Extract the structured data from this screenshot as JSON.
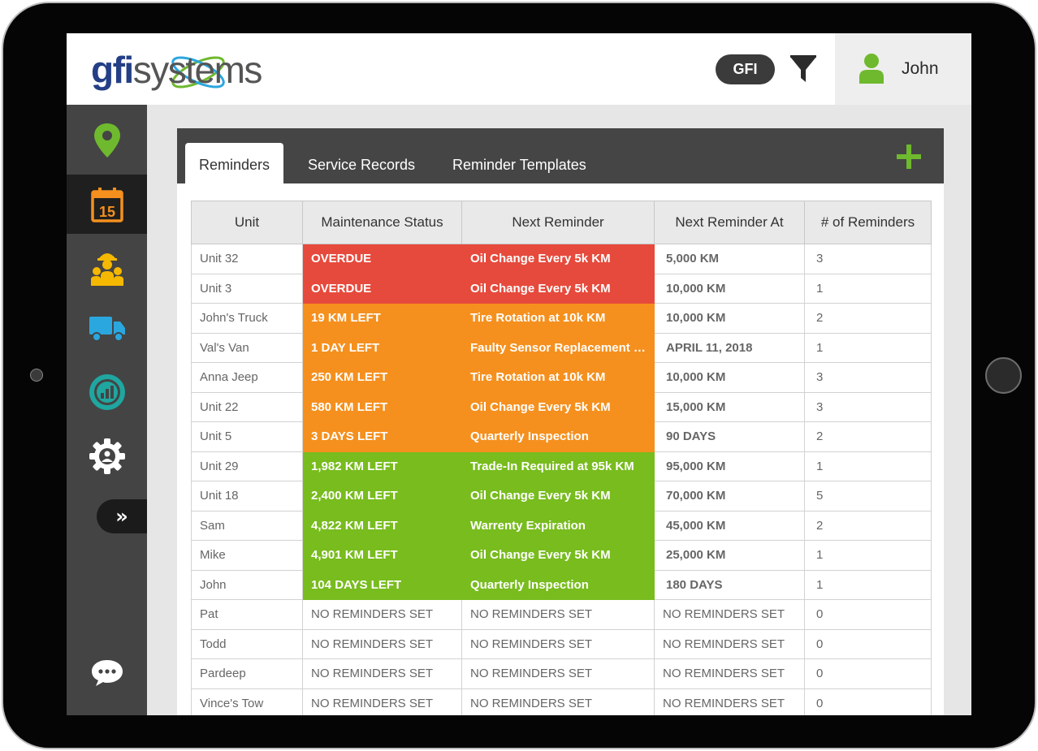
{
  "header": {
    "logo": {
      "part1": "gfi",
      "part2": "systems"
    },
    "org_badge": "GFI",
    "user_name": "John"
  },
  "colors": {
    "overdue": "#e64a3c",
    "warning": "#f5901e",
    "ok": "#78bc1e",
    "brand_green": "#6fb92e",
    "brand_blue": "#243f86"
  },
  "sidebar": {
    "items": [
      {
        "icon": "map-pin-icon",
        "active": false
      },
      {
        "icon": "calendar-icon",
        "active": true,
        "day": "15"
      },
      {
        "icon": "workers-icon",
        "active": false
      },
      {
        "icon": "truck-icon",
        "active": false
      },
      {
        "icon": "analytics-icon",
        "active": false
      },
      {
        "icon": "settings-icon",
        "active": false
      }
    ],
    "expand": "»",
    "chat_icon": "chat-icon"
  },
  "tabs": [
    {
      "label": "Reminders",
      "active": true
    },
    {
      "label": "Service Records",
      "active": false
    },
    {
      "label": "Reminder Templates",
      "active": false
    }
  ],
  "table": {
    "columns": [
      "Unit",
      "Maintenance Status",
      "Next Reminder",
      "Next Reminder At",
      "# of Reminders"
    ],
    "rows": [
      {
        "unit": "Unit 32",
        "status": "OVERDUE",
        "level": "overdue",
        "reminder": "Oil Change Every 5k KM",
        "at": "5,000 KM",
        "count": "3"
      },
      {
        "unit": "Unit 3",
        "status": "OVERDUE",
        "level": "overdue",
        "reminder": "Oil Change Every 5k KM",
        "at": "10,000 KM",
        "count": "1"
      },
      {
        "unit": "John's Truck",
        "status": "19 KM LEFT",
        "level": "warning",
        "reminder": "Tire Rotation at 10k KM",
        "at": "10,000 KM",
        "count": "2"
      },
      {
        "unit": "Val's Van",
        "status": "1 DAY LEFT",
        "level": "warning",
        "reminder": "Faulty Sensor Replacement Required",
        "at": "APRIL 11, 2018",
        "count": "1"
      },
      {
        "unit": "Anna Jeep",
        "status": "250 KM LEFT",
        "level": "warning",
        "reminder": "Tire Rotation at 10k KM",
        "at": "10,000 KM",
        "count": "3"
      },
      {
        "unit": "Unit 22",
        "status": "580 KM LEFT",
        "level": "warning",
        "reminder": "Oil Change Every 5k KM",
        "at": "15,000 KM",
        "count": "3"
      },
      {
        "unit": "Unit 5",
        "status": "3 DAYS LEFT",
        "level": "warning",
        "reminder": "Quarterly Inspection",
        "at": "90 DAYS",
        "count": "2"
      },
      {
        "unit": "Unit 29",
        "status": "1,982 KM LEFT",
        "level": "ok",
        "reminder": "Trade-In Required at 95k KM",
        "at": "95,000 KM",
        "count": "1"
      },
      {
        "unit": "Unit 18",
        "status": "2,400 KM LEFT",
        "level": "ok",
        "reminder": "Oil Change Every 5k KM",
        "at": "70,000 KM",
        "count": "5"
      },
      {
        "unit": "Sam",
        "status": "4,822 KM LEFT",
        "level": "ok",
        "reminder": "Warrenty Expiration",
        "at": "45,000 KM",
        "count": "2"
      },
      {
        "unit": "Mike",
        "status": "4,901 KM LEFT",
        "level": "ok",
        "reminder": "Oil Change Every 5k KM",
        "at": "25,000 KM",
        "count": "1"
      },
      {
        "unit": "John",
        "status": "104 DAYS LEFT",
        "level": "ok",
        "reminder": "Quarterly Inspection",
        "at": "180 DAYS",
        "count": "1"
      },
      {
        "unit": "Pat",
        "status": "NO REMINDERS SET",
        "level": "none",
        "reminder": "NO REMINDERS SET",
        "at": "NO REMINDERS SET",
        "count": "0"
      },
      {
        "unit": "Todd",
        "status": "NO REMINDERS SET",
        "level": "none",
        "reminder": "NO REMINDERS SET",
        "at": "NO REMINDERS SET",
        "count": "0"
      },
      {
        "unit": "Pardeep",
        "status": "NO REMINDERS SET",
        "level": "none",
        "reminder": "NO REMINDERS SET",
        "at": "NO REMINDERS SET",
        "count": "0"
      },
      {
        "unit": "Vince's Tow",
        "status": "NO REMINDERS SET",
        "level": "none",
        "reminder": "NO REMINDERS SET",
        "at": "NO REMINDERS SET",
        "count": "0"
      }
    ]
  }
}
